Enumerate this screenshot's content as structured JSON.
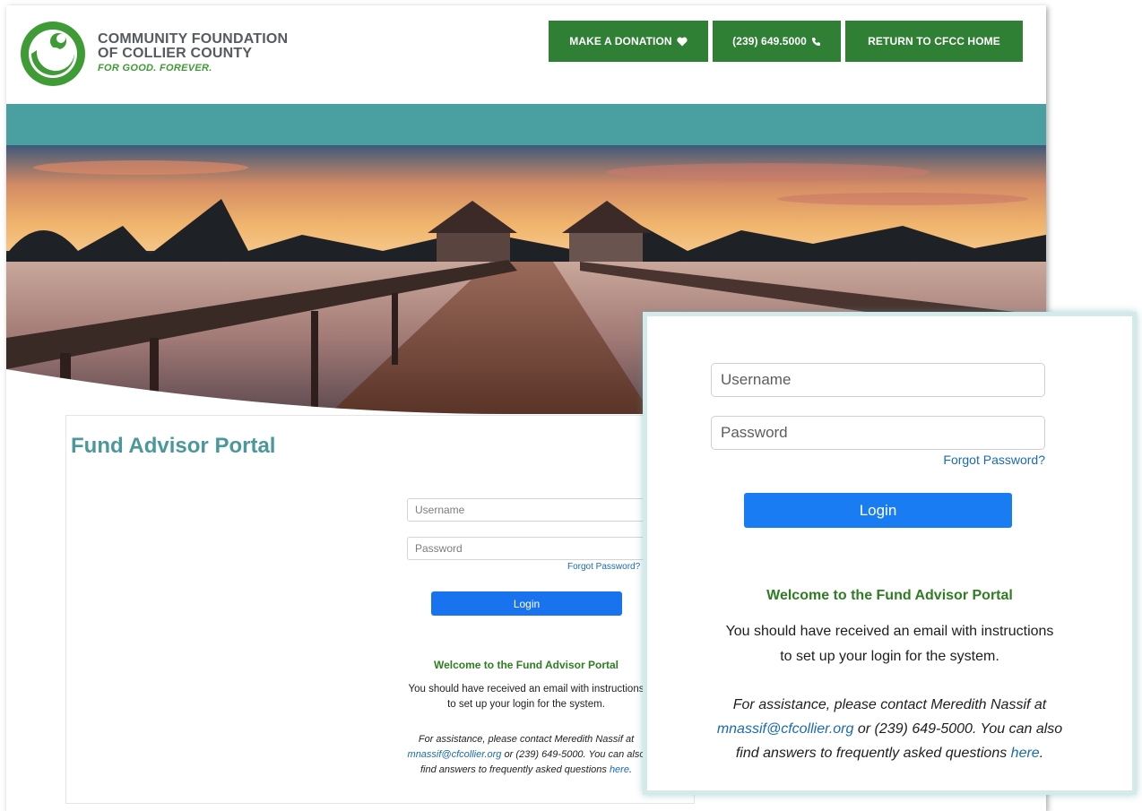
{
  "org": {
    "name_line1": "COMMUNITY FOUNDATION",
    "name_line2": "OF COLLIER COUNTY",
    "tagline": "FOR GOOD. FOREVER."
  },
  "nav": {
    "donate_label": "MAKE A DONATION",
    "phone_label": "(239) 649.5000",
    "home_label": "RETURN TO CFCC HOME"
  },
  "page_title": "Fund Advisor Portal",
  "login": {
    "username_placeholder": "Username",
    "password_placeholder": "Password",
    "forgot_label": "Forgot Password?",
    "login_label": "Login"
  },
  "welcome": {
    "heading": "Welcome to the Fund Advisor Portal",
    "message_line1": "You should have received an email with instructions",
    "message_line2": "to set up your login for the system.",
    "assist_pre": "For assistance, please contact Meredith Nassif at",
    "assist_email": "mnassif@cfcollier.org",
    "assist_mid": " or (239) 649-5000. You can also",
    "assist_post": "find answers to frequently asked questions ",
    "assist_link": "here",
    "assist_end": "."
  },
  "colors": {
    "brand_green": "#2f7f34",
    "teal_band": "#4a9fa1",
    "title_teal": "#4b989c",
    "login_blue": "#1a73ee",
    "welcome_green": "#2f7d23"
  },
  "icons": [
    "heart-icon",
    "phone-icon",
    "logo-swirl-icon"
  ]
}
